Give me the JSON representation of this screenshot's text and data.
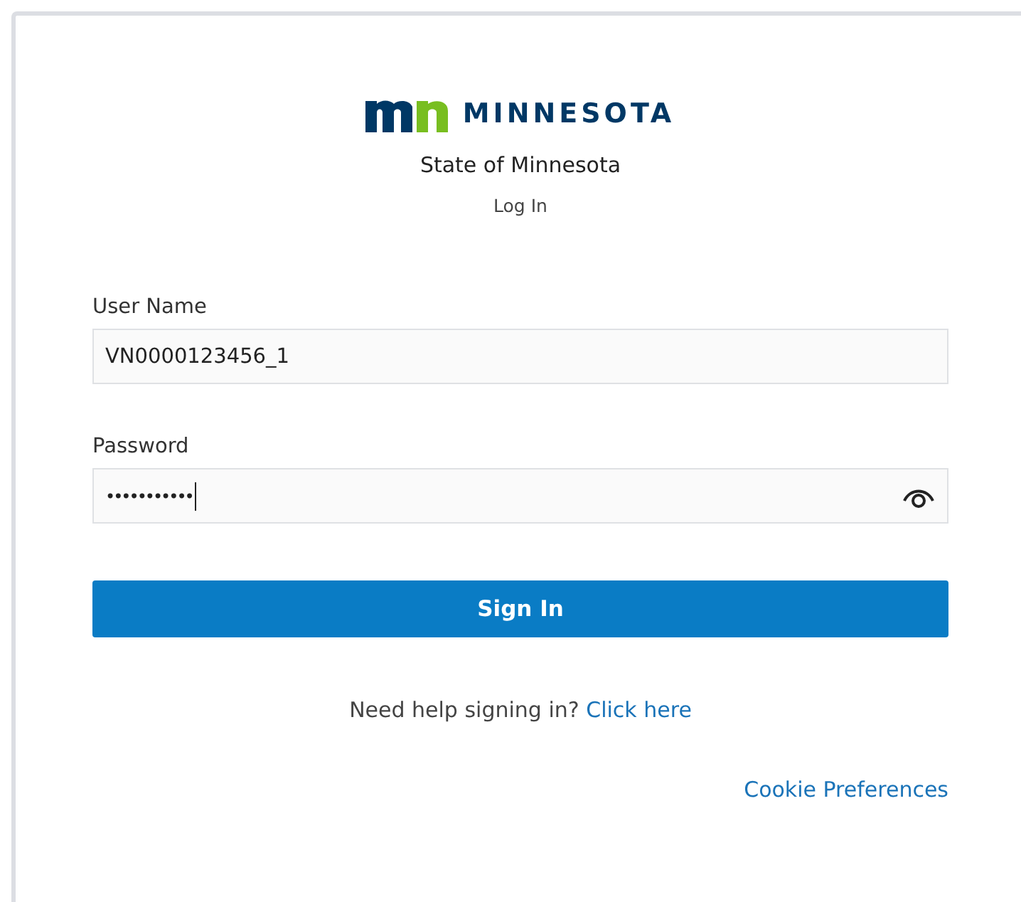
{
  "logo": {
    "wordmark": "MINNESOTA"
  },
  "title": "State of Minnesota",
  "subtitle": "Log In",
  "fields": [
    {
      "kind": "text",
      "label": "User Name",
      "value": "VN0000123456_1"
    },
    {
      "kind": "password",
      "label": "Password",
      "value": "•••••••••••"
    }
  ],
  "sign_in_button": "Sign In",
  "help": {
    "text": "Need help signing in?",
    "link": "Click here"
  },
  "cookie_link": "Cookie Preferences"
}
